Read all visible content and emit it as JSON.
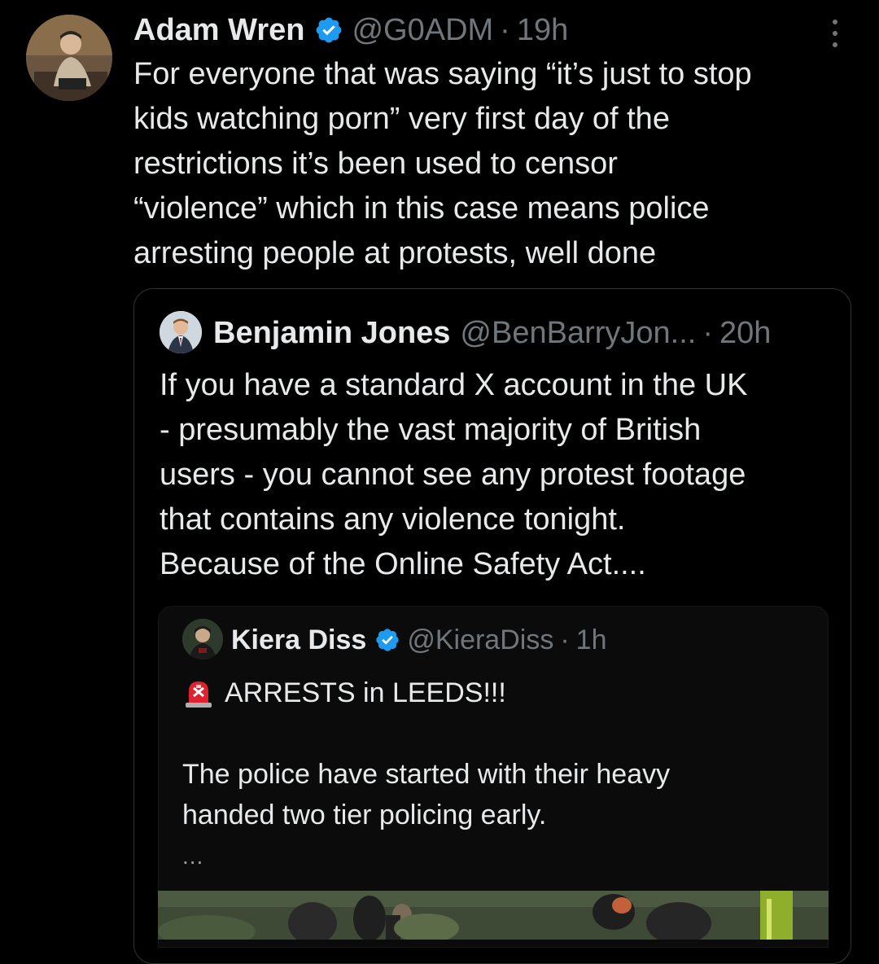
{
  "tweet": {
    "author_name": "Adam Wren",
    "handle": "@G0ADM",
    "separator": "·",
    "time": "19h",
    "avatar_icon": "user-avatar-photo",
    "verified_icon": "verified-badge-icon",
    "more_icon": "more-options-icon",
    "lines": [
      "For everyone that was saying “it’s just to stop",
      "kids watching porn” very first day of the",
      "restrictions it’s been used to censor",
      "“violence” which in this case means police",
      "arresting people at protests, well done"
    ]
  },
  "quote": {
    "author_name": "Benjamin Jones",
    "handle": "@BenBarryJon...",
    "separator": "·",
    "time": "20h",
    "lines": [
      "If you have a standard X account in the UK",
      "- presumably the vast majority of British",
      "users - you cannot see any protest footage",
      "that contains any violence tonight.",
      "Because of the Online Safety Act...."
    ]
  },
  "inner": {
    "author_name": "Kiera Diss",
    "handle": "@KieraDiss",
    "separator": "·",
    "time": "1h",
    "headline": "ARRESTS in LEEDS!!!",
    "headline_icon": "siren-icon",
    "paragraph": [
      "The police have started with their heavy",
      "handed two tier policing early."
    ],
    "ellipsis": "..."
  },
  "colors": {
    "background": "#000000",
    "text": "#e7e9ea",
    "muted": "#71767b",
    "verified_blue": "#1d9bf0",
    "border": "#2f3336"
  }
}
